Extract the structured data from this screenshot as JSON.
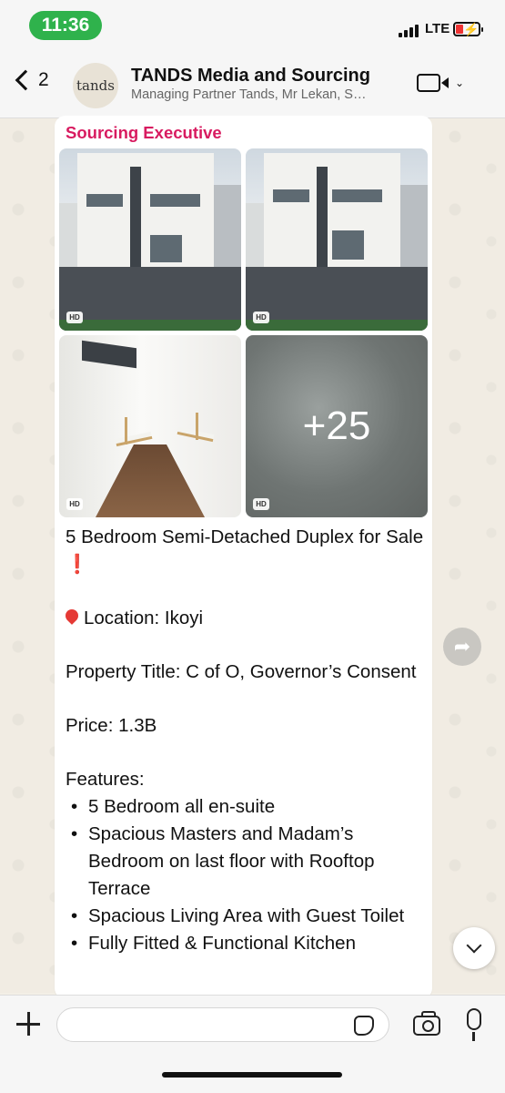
{
  "status_bar": {
    "time": "11:36",
    "network": "LTE",
    "time_pill_color": "#2fb24c",
    "battery_color": "#e33333"
  },
  "header": {
    "back_count": "2",
    "avatar_text": "tands",
    "title": "TANDS Media and Sourcing",
    "subtitle": "Managing Partner Tands, Mr Lekan, S…"
  },
  "message": {
    "sender": "Sourcing Executive",
    "sender_color": "#d81b60",
    "media": {
      "badge": "HD",
      "more_count": "+25"
    },
    "headline": "5 Bedroom Semi-Detached Duplex for Sale",
    "headline_emoji": "❗",
    "location": "Location: Ikoyi",
    "title_line": "Property Title: C of O, Governor’s Consent",
    "price": "Price: 1.3B",
    "features_heading": "Features:",
    "features": [
      "5 Bedroom all en-suite",
      "Spacious Masters and Madam’s Bedroom on last floor with Rooftop Terrace",
      "Spacious Living Area with Guest Toilet",
      "Fully Fitted & Functional Kitchen"
    ]
  },
  "icons": {
    "forward": "forward-icon",
    "scroll_down": "chevron-down-icon",
    "plus": "plus-icon",
    "sticker": "sticker-icon",
    "camera": "camera-icon",
    "mic": "microphone-icon",
    "video": "video-call-icon"
  },
  "input": {
    "placeholder": "",
    "value": ""
  }
}
